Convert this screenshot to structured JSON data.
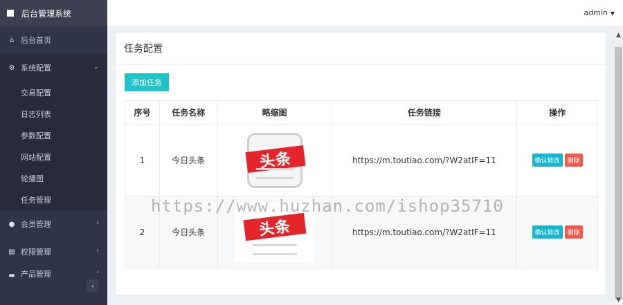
{
  "sidebar": {
    "brand": "后台管理系统",
    "items": [
      {
        "label": "后台首页",
        "icon": "home-icon"
      },
      {
        "label": "系统配置",
        "icon": "gears-icon"
      },
      {
        "label": "会员管理",
        "icon": "user-icon"
      },
      {
        "label": "权限管理",
        "icon": "id-card-icon"
      },
      {
        "label": "产品管理",
        "icon": "folder-icon"
      }
    ],
    "submenu": [
      "交易配置",
      "日志列表",
      "参数配置",
      "网站配置",
      "轮播图",
      "任务管理"
    ]
  },
  "topbar": {
    "user": "admin"
  },
  "panel": {
    "title": "任务配置",
    "add_button": "添加任务",
    "table": {
      "headers": [
        "序号",
        "任务名称",
        "略缩图",
        "任务链接",
        "操作"
      ],
      "rows": [
        {
          "id": "1",
          "name": "今日头条",
          "thumb_text": "头条",
          "link": "https://m.toutiao.com/?W2atIF=11",
          "edit": "确认修改",
          "delete": "删除"
        },
        {
          "id": "2",
          "name": "今日头条",
          "thumb_text": "头条",
          "link": "https://m.toutiao.com/?W2atIF=11",
          "edit": "确认修改",
          "delete": "删除"
        }
      ]
    }
  },
  "watermark": "https://www.huzhan.com/ishop35710",
  "colors": {
    "sidebar_bg": "#2f3446",
    "accent": "#22c0c8",
    "danger": "#f05a4d",
    "brand_red": "#e4262c"
  }
}
